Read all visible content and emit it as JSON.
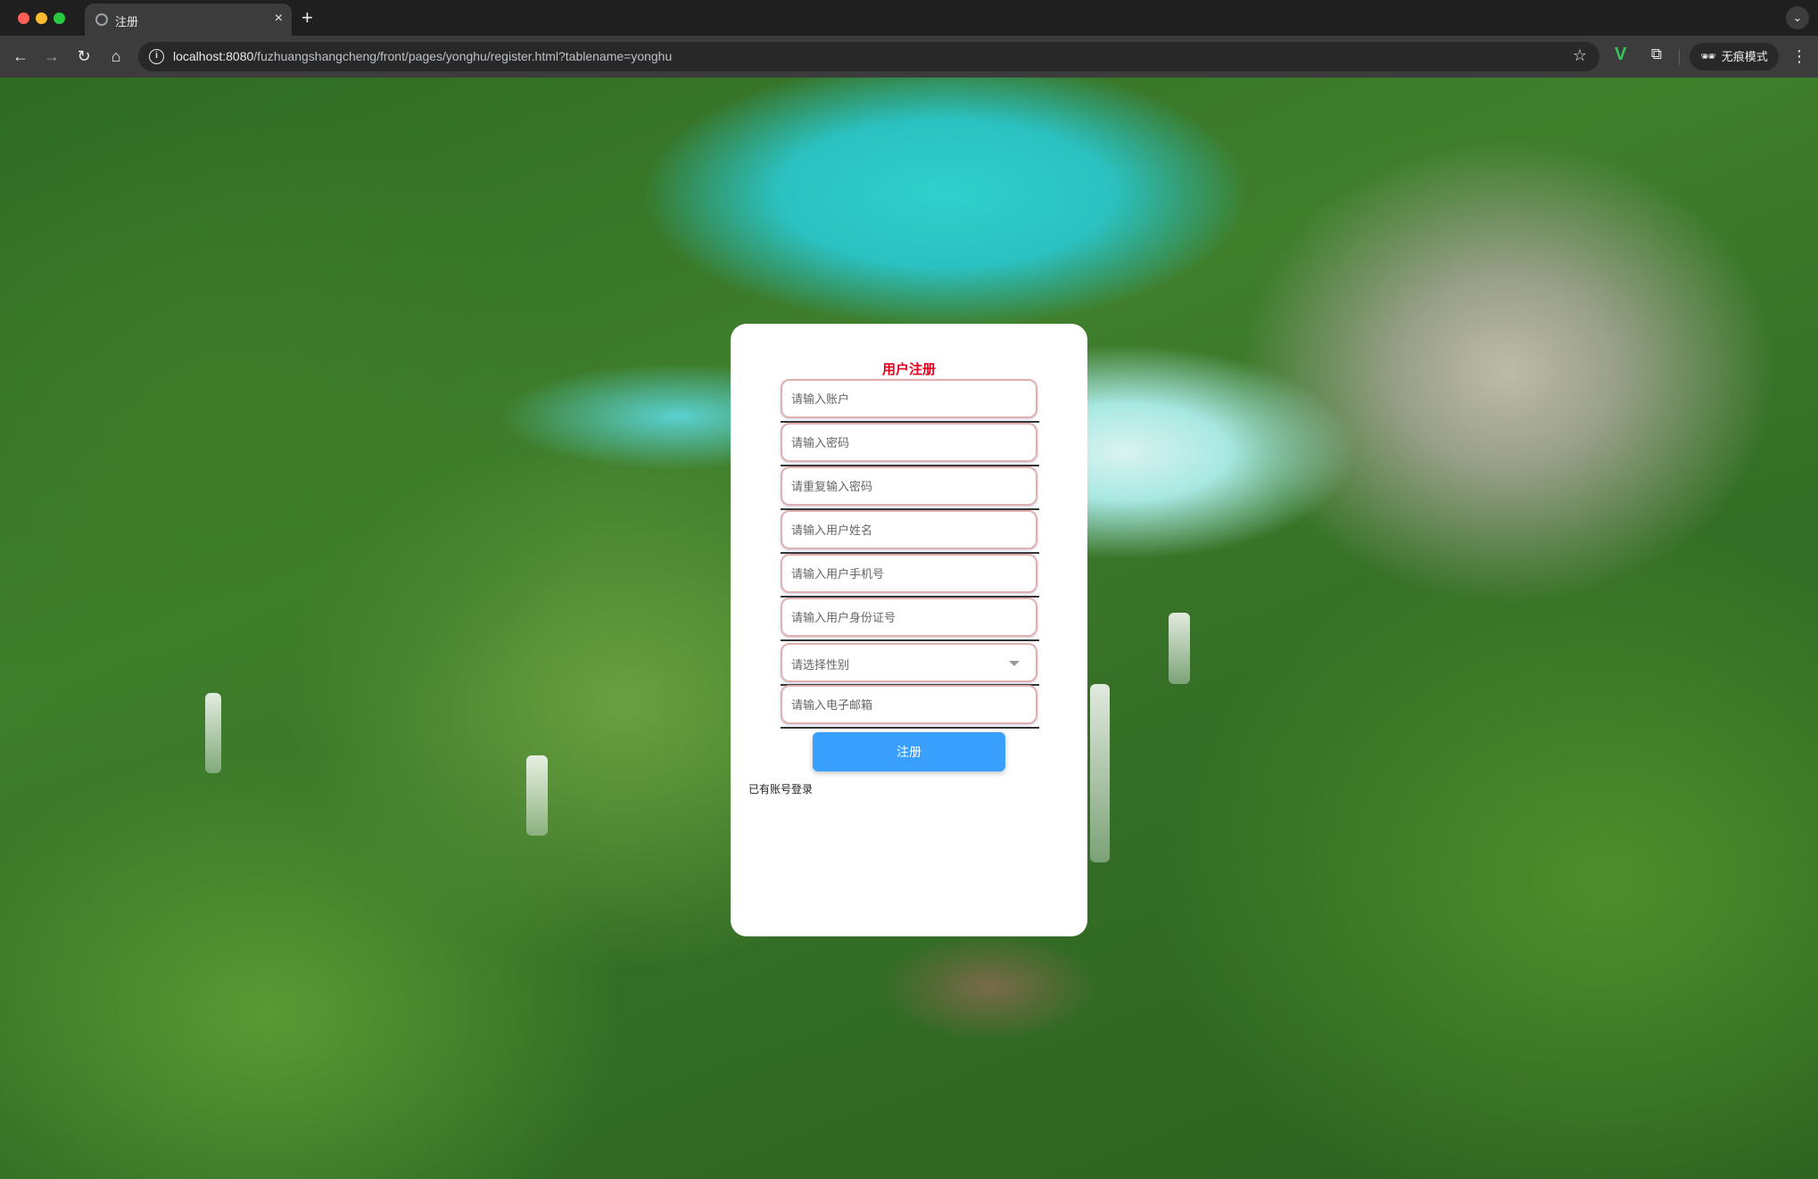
{
  "browser": {
    "tab_title": "注册",
    "tab_close": "×",
    "new_tab": "+",
    "tab_menu": "⌄",
    "url_host": "localhost:8080",
    "url_path": "/fuzhuangshangcheng/front/pages/yonghu/register.html?tablename=yonghu",
    "incognito_label": "无痕模式",
    "icons": {
      "back": "←",
      "forward": "→",
      "reload": "↻",
      "home": "⌂",
      "info": "i",
      "star": "☆",
      "extension_v": "V",
      "puzzle": "⧉",
      "incognito": "🕶",
      "menu": "⋮"
    }
  },
  "register": {
    "title": "用户注册",
    "fields": {
      "account_placeholder": "请输入账户",
      "password_placeholder": "请输入密码",
      "repeat_password_placeholder": "请重复输入密码",
      "name_placeholder": "请输入用户姓名",
      "phone_placeholder": "请输入用户手机号",
      "idcard_placeholder": "请输入用户身份证号",
      "gender_placeholder": "请选择性别",
      "email_placeholder": "请输入电子邮箱"
    },
    "submit_label": "注册",
    "login_link": "已有账号登录"
  },
  "colors": {
    "title_red": "#e3001b",
    "button_blue": "#3aa0ff",
    "field_border": "#e3b0b0"
  }
}
